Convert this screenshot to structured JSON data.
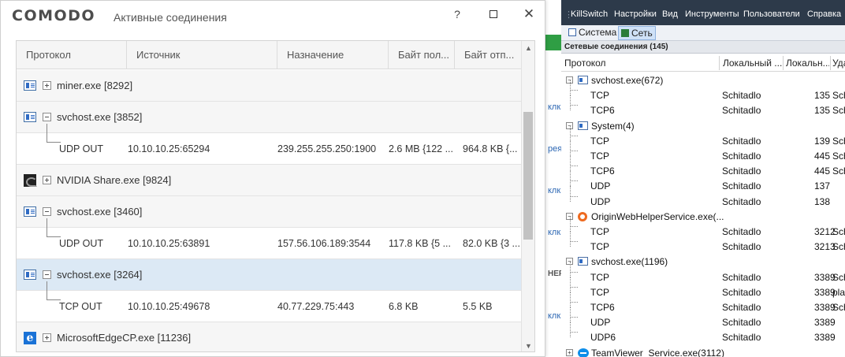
{
  "comodo": {
    "logo": "COMODO",
    "title": "Активные соединения",
    "help_glyph": "?",
    "close_glyph": "✕",
    "columns": [
      "Протокол",
      "Источник",
      "Назначение",
      "Байт пол...",
      "Байт отп..."
    ],
    "rows": [
      {
        "type": "process",
        "icon": "window-icon",
        "expanded": false,
        "name": "miner.exe [8292]"
      },
      {
        "type": "process",
        "icon": "window-icon",
        "expanded": true,
        "name": "svchost.exe [3852]"
      },
      {
        "type": "connection",
        "protocol": "UDP OUT",
        "source": "10.10.10.25:65294",
        "destination": "239.255.255.250:1900",
        "received": "2.6 MB {122 ...",
        "sent": "964.8 KB {..."
      },
      {
        "type": "process",
        "icon": "nvidia-icon",
        "expanded": false,
        "name": "NVIDIA Share.exe [9824]"
      },
      {
        "type": "process",
        "icon": "window-icon",
        "expanded": true,
        "name": "svchost.exe [3460]"
      },
      {
        "type": "connection",
        "protocol": "UDP OUT",
        "source": "10.10.10.25:63891",
        "destination": "157.56.106.189:3544",
        "received": "117.8 KB {5 ...",
        "sent": "82.0 KB {3 ..."
      },
      {
        "type": "process",
        "icon": "window-icon",
        "expanded": true,
        "selected": true,
        "name": "svchost.exe [3264]"
      },
      {
        "type": "connection",
        "protocol": "TCP OUT",
        "source": "10.10.10.25:49678",
        "destination": "40.77.229.75:443",
        "received": "6.8 KB",
        "sent": "5.5 KB"
      },
      {
        "type": "process",
        "icon": "edge-icon",
        "expanded": false,
        "name": "MicrosoftEdgeCP.exe [11236]"
      }
    ]
  },
  "background_app": {
    "menu": [
      "KillSwitch",
      "Настройки",
      "Вид",
      "Инструменты",
      "Пользователи",
      "Справка"
    ],
    "tabs": [
      "Система",
      "Сеть"
    ],
    "section_title": "Сетевые соединения (145)",
    "columns": [
      "Протокол",
      "Локальный ...",
      "Локальн...",
      "Уда"
    ],
    "rows": [
      {
        "kind": "group",
        "icon": "window-icon",
        "name": "svchost.exe(672)"
      },
      {
        "kind": "item",
        "protocol": "TCP",
        "host": "Schitadlo",
        "port": "135",
        "remote": "Sch"
      },
      {
        "kind": "item",
        "protocol": "TCP6",
        "host": "Schitadlo",
        "port": "135",
        "remote": "Sch"
      },
      {
        "kind": "group",
        "icon": "system-icon",
        "name": "System(4)"
      },
      {
        "kind": "item",
        "protocol": "TCP",
        "host": "Schitadlo",
        "port": "139",
        "remote": "Sch"
      },
      {
        "kind": "item",
        "protocol": "TCP",
        "host": "Schitadlo",
        "port": "445",
        "remote": "Sch"
      },
      {
        "kind": "item",
        "protocol": "TCP6",
        "host": "Schitadlo",
        "port": "445",
        "remote": "Sch"
      },
      {
        "kind": "item",
        "protocol": "UDP",
        "host": "Schitadlo",
        "port": "137",
        "remote": ""
      },
      {
        "kind": "item",
        "protocol": "UDP",
        "host": "Schitadlo",
        "port": "138",
        "remote": ""
      },
      {
        "kind": "group",
        "icon": "origin-icon",
        "name": "OriginWebHelperService.exe(..."
      },
      {
        "kind": "item",
        "protocol": "TCP",
        "host": "Schitadlo",
        "port": "3212",
        "remote": "Sch"
      },
      {
        "kind": "item",
        "protocol": "TCP",
        "host": "Schitadlo",
        "port": "3213",
        "remote": "Sch"
      },
      {
        "kind": "group",
        "icon": "window-icon",
        "name": "svchost.exe(1196)"
      },
      {
        "kind": "item",
        "protocol": "TCP",
        "host": "Schitadlo",
        "port": "3389",
        "remote": "Sch"
      },
      {
        "kind": "item",
        "protocol": "TCP",
        "host": "Schitadlo",
        "port": "3389",
        "remote": "pla"
      },
      {
        "kind": "item",
        "protocol": "TCP6",
        "host": "Schitadlo",
        "port": "3389",
        "remote": "Sch"
      },
      {
        "kind": "item",
        "protocol": "UDP",
        "host": "Schitadlo",
        "port": "3389",
        "remote": ""
      },
      {
        "kind": "item",
        "protocol": "UDP6",
        "host": "Schitadlo",
        "port": "3389",
        "remote": ""
      },
      {
        "kind": "group",
        "icon": "teamviewer-icon",
        "name": "TeamViewer_Service.exe(3112)"
      }
    ]
  },
  "strip_links": [
    "клк",
    "рея",
    "клк",
    "клк",
    "НЕР",
    "клк"
  ]
}
